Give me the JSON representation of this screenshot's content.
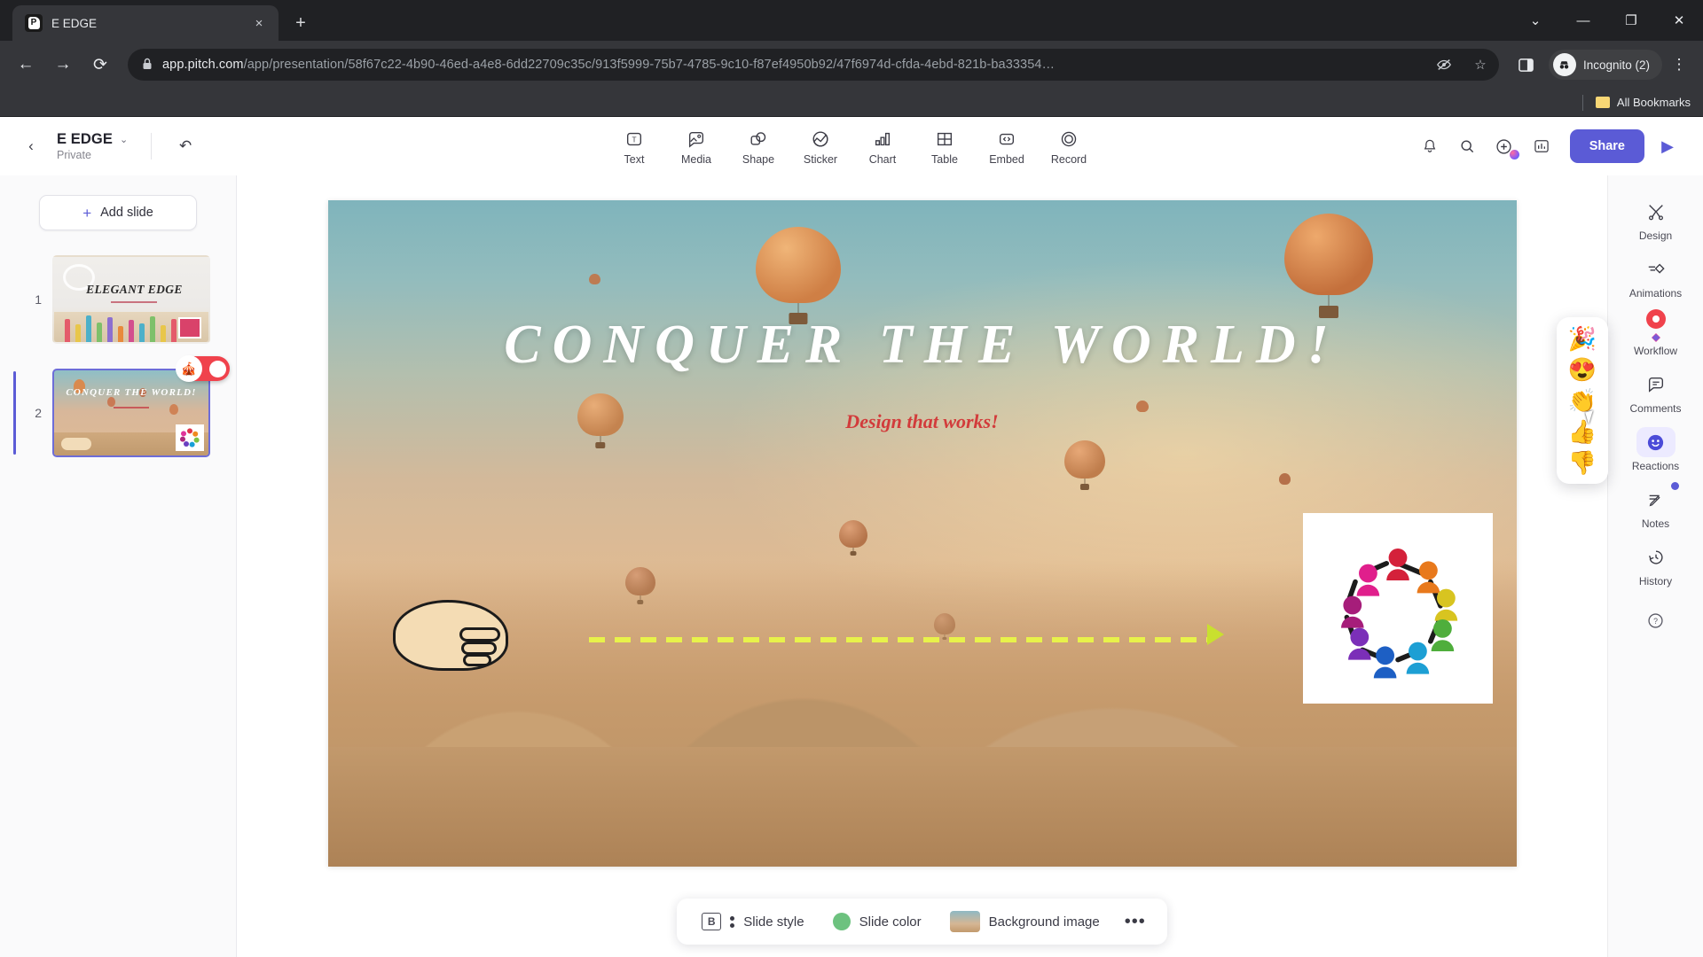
{
  "browser": {
    "tab": {
      "title": "E EDGE",
      "favicon": "pitch-logo-icon",
      "close": "×"
    },
    "new_tab_label": "+",
    "window_controls": {
      "more": "⌄",
      "minimize": "—",
      "maximize": "❐",
      "close": "✕"
    },
    "nav": {
      "back": "←",
      "forward": "→",
      "reload": "⟳"
    },
    "omnibox": {
      "lock": "🔒",
      "url_host": "app.pitch.com",
      "url_path": "/app/presentation/58f67c22-4b90-46ed-a4e8-6dd22709c35c/913f5999-75b7-4785-9c10-f87ef4950b92/47f6974d-cfda-4ebd-821b-ba33354…",
      "hide_icon": "no-tracking-icon",
      "bookmark_icon": "☆"
    },
    "side_panel_icon": "side-panel-icon",
    "profile": {
      "label": "Incognito (2)",
      "icon": "incognito-icon"
    },
    "menu": "⋮",
    "bookmarks_bar": {
      "label": "All Bookmarks"
    }
  },
  "app": {
    "back": "‹",
    "deck": {
      "title": "E EDGE",
      "visibility": "Private",
      "chevron": "⌄"
    },
    "undo": "↶",
    "insert_tools": [
      {
        "label": "Text",
        "icon": "text-icon"
      },
      {
        "label": "Media",
        "icon": "media-icon"
      },
      {
        "label": "Shape",
        "icon": "shape-icon"
      },
      {
        "label": "Sticker",
        "icon": "sticker-icon"
      },
      {
        "label": "Chart",
        "icon": "chart-icon"
      },
      {
        "label": "Table",
        "icon": "table-icon"
      },
      {
        "label": "Embed",
        "icon": "embed-icon"
      },
      {
        "label": "Record",
        "icon": "record-icon"
      }
    ],
    "top_right": {
      "notifications": "notification-bell-icon",
      "search": "search-icon",
      "add": "+",
      "analytics": "analytics-icon",
      "share_label": "Share",
      "present": "▶"
    },
    "sidebar": {
      "add_slide_label": "Add slide",
      "add_slide_plus": "+",
      "slides": [
        {
          "number": "1",
          "title": "ELEGANT EDGE",
          "selected": false
        },
        {
          "number": "2",
          "title": "CONQUER THE WORLD!",
          "selected": true
        }
      ]
    },
    "slide": {
      "title": "CONQUER THE WORLD!",
      "subtitle": "Design that works!",
      "logo_alt": "teamwork-circle-logo"
    },
    "right_rail": [
      {
        "label": "Design",
        "icon": "design-icon",
        "badge": false
      },
      {
        "label": "Animations",
        "icon": "animations-icon",
        "badge": false
      },
      {
        "label": "Workflow",
        "icon": "workflow-icon",
        "badge": false
      },
      {
        "label": "Comments",
        "icon": "comments-icon",
        "badge": false
      },
      {
        "label": "Reactions",
        "icon": "reactions-icon",
        "badge": false
      },
      {
        "label": "Notes",
        "icon": "notes-icon",
        "badge": true
      },
      {
        "label": "History",
        "icon": "history-icon",
        "badge": false
      }
    ],
    "help_icon": "?",
    "reactions_popup": [
      "🎉",
      "😍",
      "👏",
      "👍",
      "👎"
    ],
    "style_bar": {
      "slide_style": "Slide style",
      "slide_color": "Slide color",
      "background_image": "Background image",
      "more": "•••",
      "style_glyph": "B",
      "color_hex": "#6dc27f"
    }
  },
  "colors": {
    "accent": "#5b5bd6",
    "chrome_bg": "#35363a",
    "tabstrip_bg": "#202124",
    "toggle_red": "#f0424c",
    "subtitle_red": "#d23b3b",
    "arrow_yellow": "#e8f24a"
  }
}
